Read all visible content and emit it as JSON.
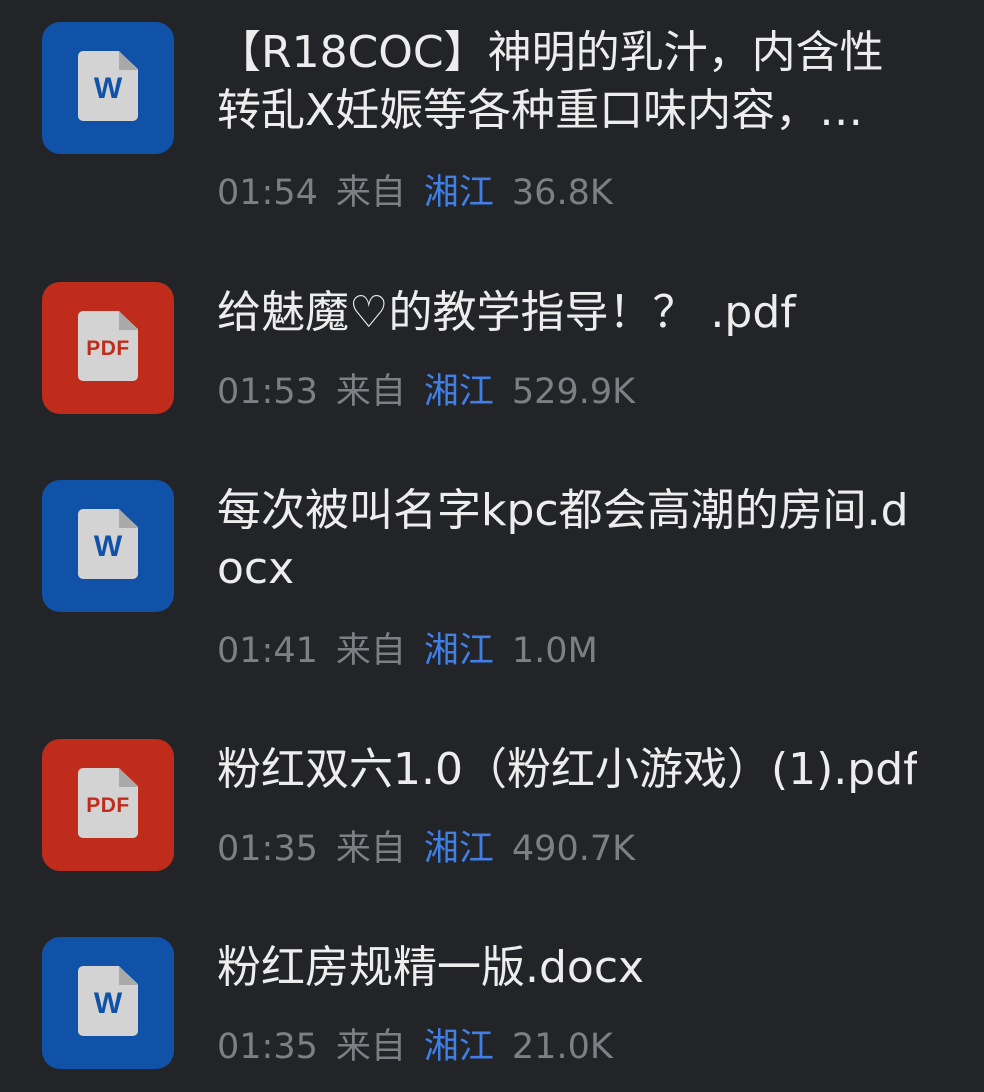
{
  "files": [
    {
      "type": "docx",
      "icon": "word-icon",
      "icon_label": "W",
      "name": "【R18COC】神明的乳汁，内含性转乱X妊娠等各种重口味内容，…",
      "time": "01:54",
      "from_label": "来自",
      "sender": "湘江",
      "size": "36.8K"
    },
    {
      "type": "pdf",
      "icon": "pdf-icon",
      "icon_label": "PDF",
      "name": "给魅魔♡的教学指导！？ .pdf",
      "time": "01:53",
      "from_label": "来自",
      "sender": "湘江",
      "size": "529.9K"
    },
    {
      "type": "docx",
      "icon": "word-icon",
      "icon_label": "W",
      "name": "每次被叫名字kpc都会高潮的房间.docx",
      "time": "01:41",
      "from_label": "来自",
      "sender": "湘江",
      "size": "1.0M"
    },
    {
      "type": "pdf",
      "icon": "pdf-icon",
      "icon_label": "PDF",
      "name": "粉红双六1.0（粉红小游戏）(1).pdf",
      "time": "01:35",
      "from_label": "来自",
      "sender": "湘江",
      "size": "490.7K"
    },
    {
      "type": "docx",
      "icon": "word-icon",
      "icon_label": "W",
      "name": "粉红房规精一版.docx",
      "time": "01:35",
      "from_label": "来自",
      "sender": "湘江",
      "size": "21.0K"
    }
  ],
  "colors": {
    "background": "#232427",
    "word_blue": "#0f52a8",
    "pdf_red": "#bf2c1b",
    "sender_link": "#3f7fe6",
    "meta_gray": "#7e7f84"
  }
}
